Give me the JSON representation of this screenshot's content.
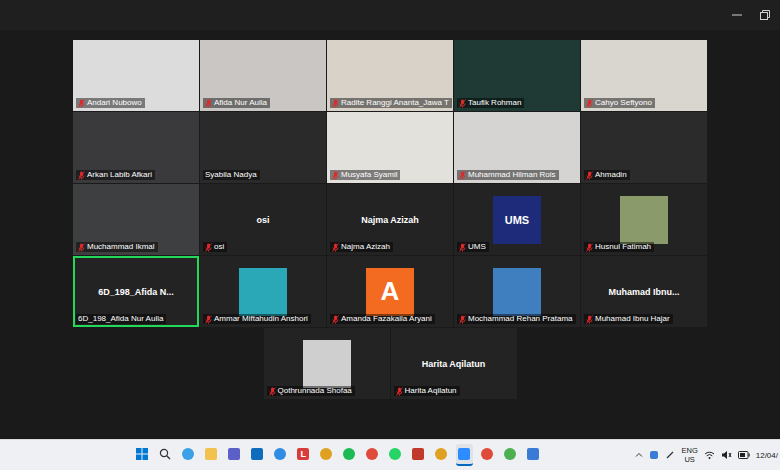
{
  "window": {
    "controls": [
      "minimize",
      "restore"
    ]
  },
  "gallery": {
    "rows": [
      [
        {
          "kind": "video",
          "label": "Andari Nubowo",
          "muted": true,
          "speaking": false,
          "color": "#dcdcdc"
        },
        {
          "kind": "video",
          "label": "Afida Nur Aulia",
          "muted": true,
          "speaking": false,
          "color": "#c9c6c4"
        },
        {
          "kind": "video",
          "label": "Radite Ranggi Ananta_Jawa T",
          "muted": true,
          "speaking": false,
          "color": "#d8d2c8"
        },
        {
          "kind": "video",
          "label": "Taufik Rohman",
          "muted": true,
          "speaking": false,
          "color": "#1f3a34"
        },
        {
          "kind": "video",
          "label": "Cahyo Seftyono",
          "muted": true,
          "speaking": false,
          "color": "#d9d6d0"
        }
      ],
      [
        {
          "kind": "video",
          "label": "Arkan Labib Afkari",
          "muted": true,
          "speaking": false,
          "color": "#3a3a3c"
        },
        {
          "kind": "video",
          "label": "Syabila Nadya",
          "muted": false,
          "speaking": false,
          "color": "#2a2a2a"
        },
        {
          "kind": "video",
          "label": "Musyafa Syamil",
          "muted": true,
          "speaking": false,
          "color": "#e3e1dc"
        },
        {
          "kind": "video",
          "label": "Muhammad Hilman Rois",
          "muted": true,
          "speaking": false,
          "color": "#d6d4d2"
        },
        {
          "kind": "video",
          "label": "Ahmadin",
          "muted": true,
          "speaking": false,
          "color": "#2b2b2b"
        }
      ],
      [
        {
          "kind": "video",
          "label": "Muchammad Ikmal",
          "muted": true,
          "speaking": false,
          "color": "#3e3f40"
        },
        {
          "kind": "name",
          "display": "osi",
          "label": "osi",
          "muted": true,
          "speaking": false
        },
        {
          "kind": "name",
          "display": "Najma Azizah",
          "label": "Najma Azizah",
          "muted": true,
          "speaking": false
        },
        {
          "kind": "avatar",
          "avatar": "UMS",
          "label": "UMS",
          "muted": true,
          "speaking": false,
          "color": "#1e2a7a"
        },
        {
          "kind": "avatar",
          "label": "Husnul Fatimah",
          "muted": true,
          "speaking": false,
          "color": "#8a9a6a"
        }
      ],
      [
        {
          "kind": "name",
          "display": "6D_198_Afida N...",
          "label": "6D_198_Afida Nur Aulia",
          "muted": false,
          "speaking": true
        },
        {
          "kind": "avatar",
          "label": "Ammar Miftahudin Anshori",
          "muted": true,
          "speaking": false,
          "color": "#2aa8b8"
        },
        {
          "kind": "avatar",
          "avatar": "A",
          "label": "Amanda Fazakaila Aryani",
          "muted": true,
          "speaking": false,
          "color": "#f26b21"
        },
        {
          "kind": "avatar",
          "label": "Mochammad Rehan Pratama",
          "muted": true,
          "speaking": false,
          "color": "#3f7fbf"
        },
        {
          "kind": "name",
          "display": "Muhamad  Ibnu...",
          "label": "Muhamad Ibnu Hajar",
          "muted": true,
          "speaking": false
        }
      ],
      [
        {
          "kind": "avatar",
          "label": "Qothrunnada Shofaa",
          "muted": true,
          "speaking": false,
          "color": "#cfcfcf"
        },
        {
          "kind": "name",
          "display": "Harita Aqilatun",
          "label": "Harita Aqilatun",
          "muted": true,
          "speaking": false
        }
      ]
    ]
  },
  "taskbar": {
    "apps": [
      {
        "kind": "windows",
        "color": "#0078d4",
        "active": false
      },
      {
        "kind": "search",
        "color": "#333333",
        "active": false
      },
      {
        "kind": "circle",
        "color": "#3aa0e8",
        "active": false
      },
      {
        "kind": "square",
        "color": "#f2c14e",
        "active": false
      },
      {
        "kind": "square",
        "color": "#5b5fc7",
        "active": false
      },
      {
        "kind": "square",
        "color": "#0f6cbd",
        "active": false
      },
      {
        "kind": "circle",
        "color": "#2f8de4",
        "active": false
      },
      {
        "kind": "letter",
        "label": "L",
        "color": "#d83b3b",
        "active": false
      },
      {
        "kind": "circle",
        "color": "#e0a020",
        "active": false
      },
      {
        "kind": "circle",
        "color": "#1db954",
        "active": false
      },
      {
        "kind": "circle",
        "color": "#e04a3a",
        "active": false
      },
      {
        "kind": "circle",
        "color": "#25d366",
        "active": false
      },
      {
        "kind": "square",
        "color": "#c0392b",
        "active": false
      },
      {
        "kind": "circle",
        "color": "#e0a020",
        "active": false
      },
      {
        "kind": "square",
        "color": "#2d8cff",
        "active": true
      },
      {
        "kind": "circle",
        "color": "#e04a3a",
        "active": false
      },
      {
        "kind": "circle",
        "color": "#4caf50",
        "active": false
      },
      {
        "kind": "square",
        "color": "#3a7bd5",
        "active": false
      }
    ],
    "tray": {
      "lang": "ENG",
      "region": "US",
      "date": "12/04/"
    }
  }
}
